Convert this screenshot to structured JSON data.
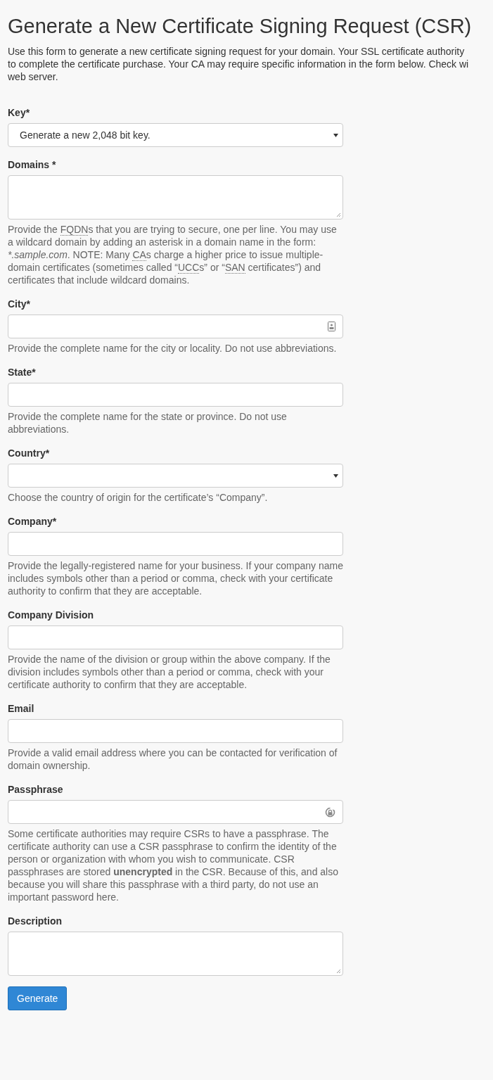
{
  "title": "Generate a New Certificate Signing Request (CSR)",
  "intro_lines": [
    "Use this form to generate a new certificate signing request for your domain. Your SSL certificate authority",
    "to complete the certificate purchase. Your CA may require specific information in the form below. Check wi",
    "web server."
  ],
  "fields": [
    {
      "kind": "select",
      "label": "Key*",
      "value": "Generate a new 2,048 bit key."
    },
    {
      "kind": "textarea",
      "label": "Domains *",
      "help": [
        {
          "kind": "plain",
          "text": "Provide the "
        },
        {
          "kind": "abbr",
          "text": "FQDN"
        },
        {
          "kind": "plain",
          "text": "s that you are trying to secure, one per line. You may use a wildcard domain by adding an asterisk in a domain name in the form: "
        },
        {
          "kind": "em",
          "text": "*.sample.com"
        },
        {
          "kind": "plain",
          "text": ". NOTE: Many "
        },
        {
          "kind": "abbr",
          "text": "CA"
        },
        {
          "kind": "plain",
          "text": "s charge a higher price to issue multiple-domain certificates (sometimes called “"
        },
        {
          "kind": "abbr",
          "text": "UCC"
        },
        {
          "kind": "plain",
          "text": "s” or “"
        },
        {
          "kind": "abbr",
          "text": "SAN"
        },
        {
          "kind": "plain",
          "text": " certificates”) and certificates that include wildcard domains."
        }
      ]
    },
    {
      "kind": "contact",
      "label": "City*",
      "help": [
        {
          "kind": "plain",
          "text": "Provide the complete name for the city or locality. Do not use abbreviations."
        }
      ]
    },
    {
      "kind": "text",
      "label": "State*",
      "help": [
        {
          "kind": "plain",
          "text": "Provide the complete name for the state or province. Do not use abbreviations."
        }
      ]
    },
    {
      "kind": "select",
      "label": "Country*",
      "help": [
        {
          "kind": "plain",
          "text": "Choose the country of origin for the certificate’s “Company”."
        }
      ]
    },
    {
      "kind": "text",
      "label": "Company*",
      "help": [
        {
          "kind": "plain",
          "text": "Provide the legally-registered name for your business. If your company name includes symbols other than a period or comma, check with your certificate authority to confirm that they are acceptable."
        }
      ]
    },
    {
      "kind": "text",
      "label": "Company Division",
      "help": [
        {
          "kind": "plain",
          "text": "Provide the name of the division or group within the above company. If the division includes symbols other than a period or comma, check with your certificate authority to confirm that they are acceptable."
        }
      ]
    },
    {
      "kind": "text",
      "label": "Email",
      "help": [
        {
          "kind": "plain",
          "text": "Provide a valid email address where you can be contacted for verification of domain ownership."
        }
      ]
    },
    {
      "kind": "password",
      "label": "Passphrase",
      "help": [
        {
          "kind": "plain",
          "text": "Some certificate authorities may require CSRs to have a passphrase. The certificate authority can use a CSR passphrase to confirm the identity of the person or organization with whom you wish to communicate. CSR passphrases are stored "
        },
        {
          "kind": "strong",
          "text": "unencrypted"
        },
        {
          "kind": "plain",
          "text": " in the CSR. Because of this, and also because you will share this passphrase with a third party, do not use an important password here."
        }
      ]
    },
    {
      "kind": "textarea",
      "label": "Description"
    }
  ],
  "button": "Generate"
}
